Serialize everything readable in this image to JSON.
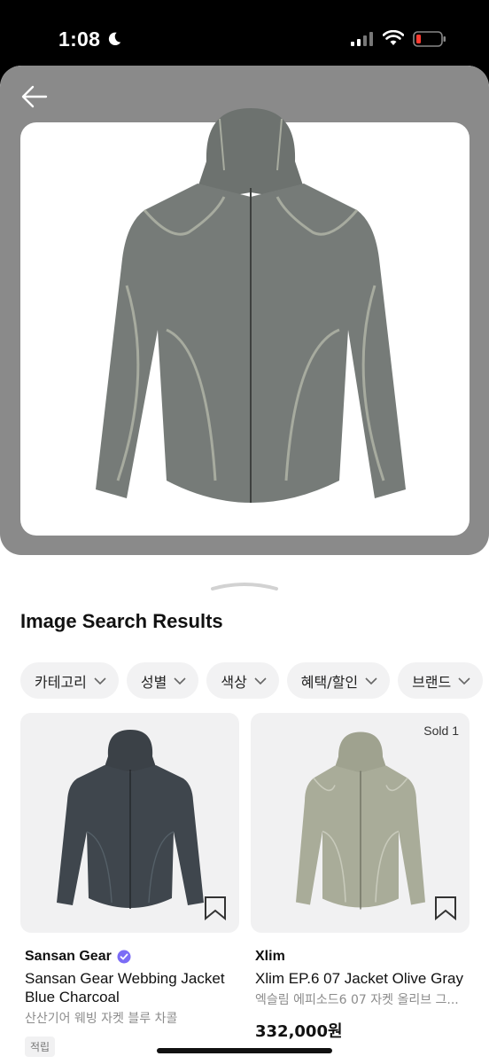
{
  "status_bar": {
    "time": "1:08",
    "icons": [
      "moon-icon",
      "signal-icon",
      "wifi-icon",
      "battery-low-icon"
    ]
  },
  "preview": {
    "back_icon": "arrow-left-icon",
    "image": "gray hooded jacket with webbing"
  },
  "results": {
    "title": "Image Search Results"
  },
  "filters": [
    {
      "label": "카테고리"
    },
    {
      "label": "성별"
    },
    {
      "label": "색상"
    },
    {
      "label": "혜택/할인"
    },
    {
      "label": "브랜드"
    }
  ],
  "products": [
    {
      "brand": "Sansan Gear",
      "verified": true,
      "name": "Sansan Gear Webbing Jacket Blue Charcoal",
      "subtitle": "산산기어 웨빙 자켓 블루 차콜",
      "tag": "적립",
      "price": "",
      "color": "#3b4147"
    },
    {
      "brand": "Xlim",
      "sold": "Sold 1",
      "name": "Xlim EP.6 07 Jacket Olive Gray",
      "subtitle": "엑슬림 에피소드6 07 자켓 올리브 그...",
      "price": "332,000원",
      "color": "#a4a793"
    }
  ],
  "colors": {
    "accent": "#7b6cf6",
    "preview_bg": "#8a8a8a",
    "chip_bg": "#f2f2f3"
  }
}
